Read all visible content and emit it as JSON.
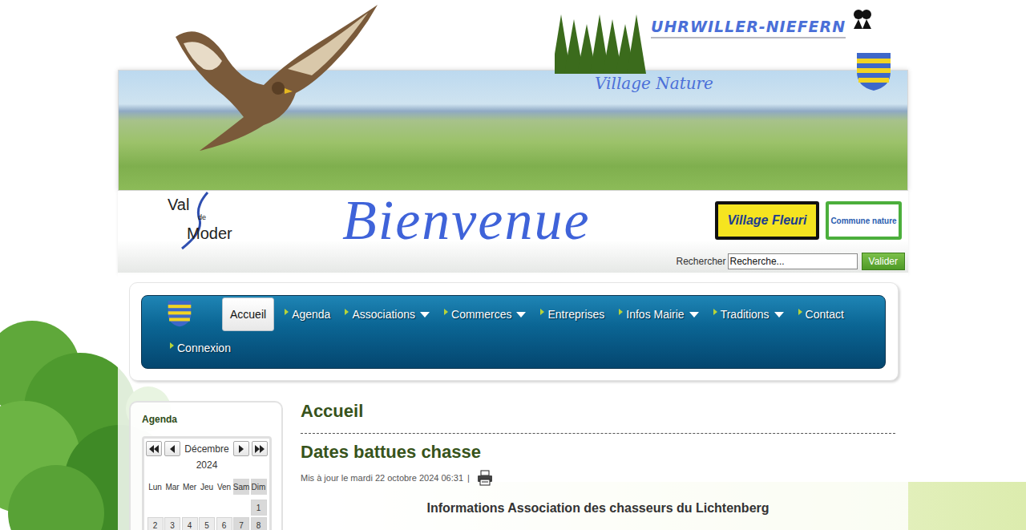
{
  "site": {
    "title": "UHRWILLER-NIEFERN",
    "tagline": "Village Nature",
    "welcome": "Bienvenue",
    "partner": {
      "top": "Val",
      "middle": "de",
      "bottom": "Moder"
    },
    "badges": [
      {
        "label": "Village Fleuri",
        "kind": "fleuri"
      },
      {
        "label": "Commune nature",
        "kind": "nature"
      }
    ]
  },
  "search": {
    "label": "Rechercher",
    "placeholder": "Recherche...",
    "button": "Valider"
  },
  "nav": [
    {
      "label": "Accueil",
      "selected": true,
      "dropdown": false
    },
    {
      "label": "Agenda",
      "selected": false,
      "dropdown": false
    },
    {
      "label": "Associations",
      "selected": false,
      "dropdown": true
    },
    {
      "label": "Commerces",
      "selected": false,
      "dropdown": true
    },
    {
      "label": "Entreprises",
      "selected": false,
      "dropdown": false
    },
    {
      "label": "Infos Mairie",
      "selected": false,
      "dropdown": true
    },
    {
      "label": "Traditions",
      "selected": false,
      "dropdown": true
    },
    {
      "label": "Contact",
      "selected": false,
      "dropdown": false
    },
    {
      "label": "Connexion",
      "selected": false,
      "dropdown": false
    }
  ],
  "calendar": {
    "title": "Agenda",
    "month": "Décembre",
    "year": "2024",
    "weekdays": [
      {
        "label": "Lun",
        "weekend": false
      },
      {
        "label": "Mar",
        "weekend": false
      },
      {
        "label": "Mer",
        "weekend": false
      },
      {
        "label": "Jeu",
        "weekend": false
      },
      {
        "label": "Ven",
        "weekend": false
      },
      {
        "label": "Sam",
        "weekend": true
      },
      {
        "label": "Dim",
        "weekend": true
      }
    ],
    "weeks": [
      [
        "",
        "",
        "",
        "",
        "",
        "",
        "1"
      ],
      [
        "2",
        "3",
        "4",
        "5",
        "6",
        "7",
        "8"
      ]
    ]
  },
  "article": {
    "heading": "Accueil",
    "title": "Dates battues chasse",
    "meta": "Mis à jour le mardi 22 octobre 2024 06:31",
    "separator": "|",
    "lead": "Informations Association des chasseurs du Lichtenberg"
  }
}
